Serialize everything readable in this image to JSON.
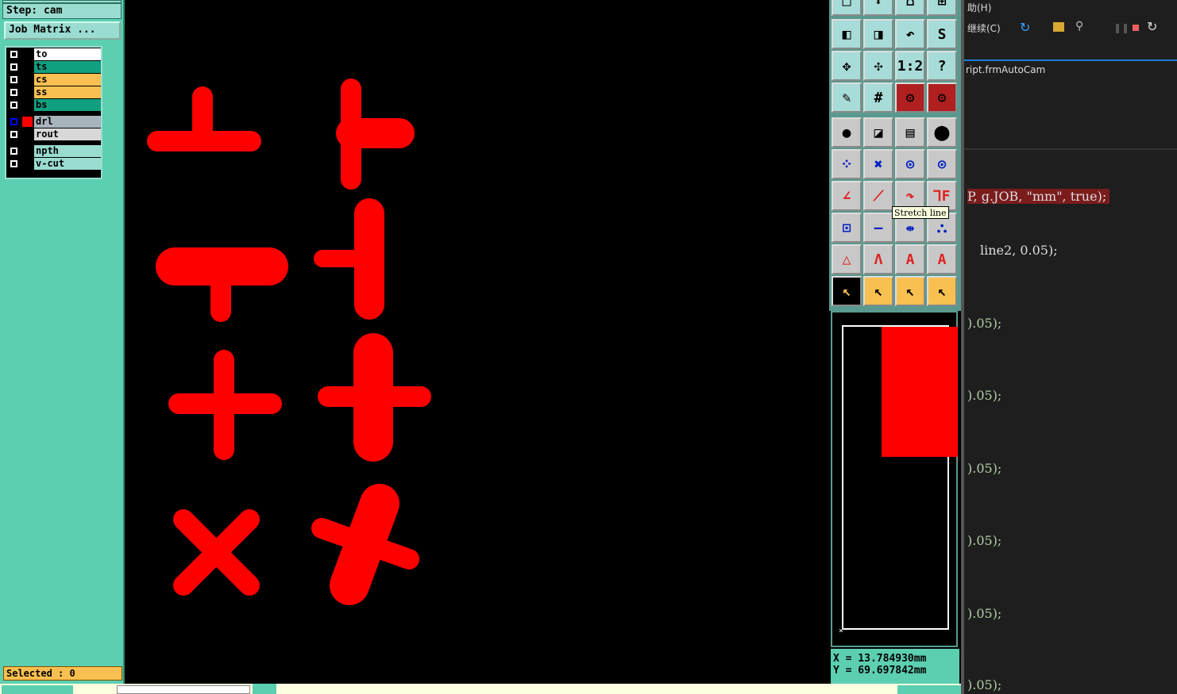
{
  "left_panel": {
    "step_label": "Step: cam",
    "job_matrix_button": "Job Matrix ...",
    "layers": [
      {
        "name": "to",
        "color": "#ffffff"
      },
      {
        "name": "ts",
        "color": "#10a080"
      },
      {
        "name": "cs",
        "color": "#f8c050"
      },
      {
        "name": "ss",
        "color": "#f8c050"
      },
      {
        "name": "bs",
        "color": "#10a080"
      },
      {
        "name": "drl",
        "color": "#a8b4bc",
        "active": true,
        "swatch": "#ff0000"
      },
      {
        "name": "rout",
        "color": "#d8d8d8"
      },
      {
        "name": "npth",
        "color": "#9adcd0"
      },
      {
        "name": "v-cut",
        "color": "#9adcd0"
      }
    ],
    "selected": "Selected : 0"
  },
  "toolbar": {
    "tooltip": "Stretch line"
  },
  "coords": {
    "x": "X = 13.784930mm",
    "y": "Y = 69.697842mm"
  },
  "ide": {
    "menu_help": "助(H)",
    "continue_label": "继续(C)",
    "tab": "ript.frmAutoCam",
    "lines": [
      "P, g.JOB, \"mm\", true);",
      "line2, 0.05);",
      ").05);",
      ").05);",
      ").05);",
      ").05);",
      ").05);",
      ").05);"
    ]
  },
  "colors": {
    "feature": "#ff0000",
    "panel": "#5ccfb0"
  }
}
